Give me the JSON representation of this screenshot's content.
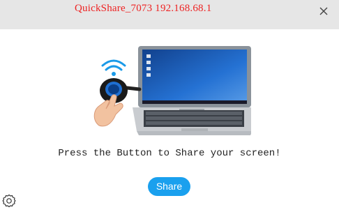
{
  "header": {
    "device_title": "QuickShare_7073 192.168.68.1"
  },
  "main": {
    "prompt_text": "Press the Button to Share your screen!"
  },
  "actions": {
    "share_label": "Share"
  },
  "icons": {
    "close": "close-icon",
    "settings": "settings-icon",
    "illustration": "laptop-with-share-button-illustration"
  },
  "colors": {
    "title_red": "#ee2222",
    "share_blue": "#1aa0ee",
    "titlebar_gray": "#e6e6e6"
  }
}
